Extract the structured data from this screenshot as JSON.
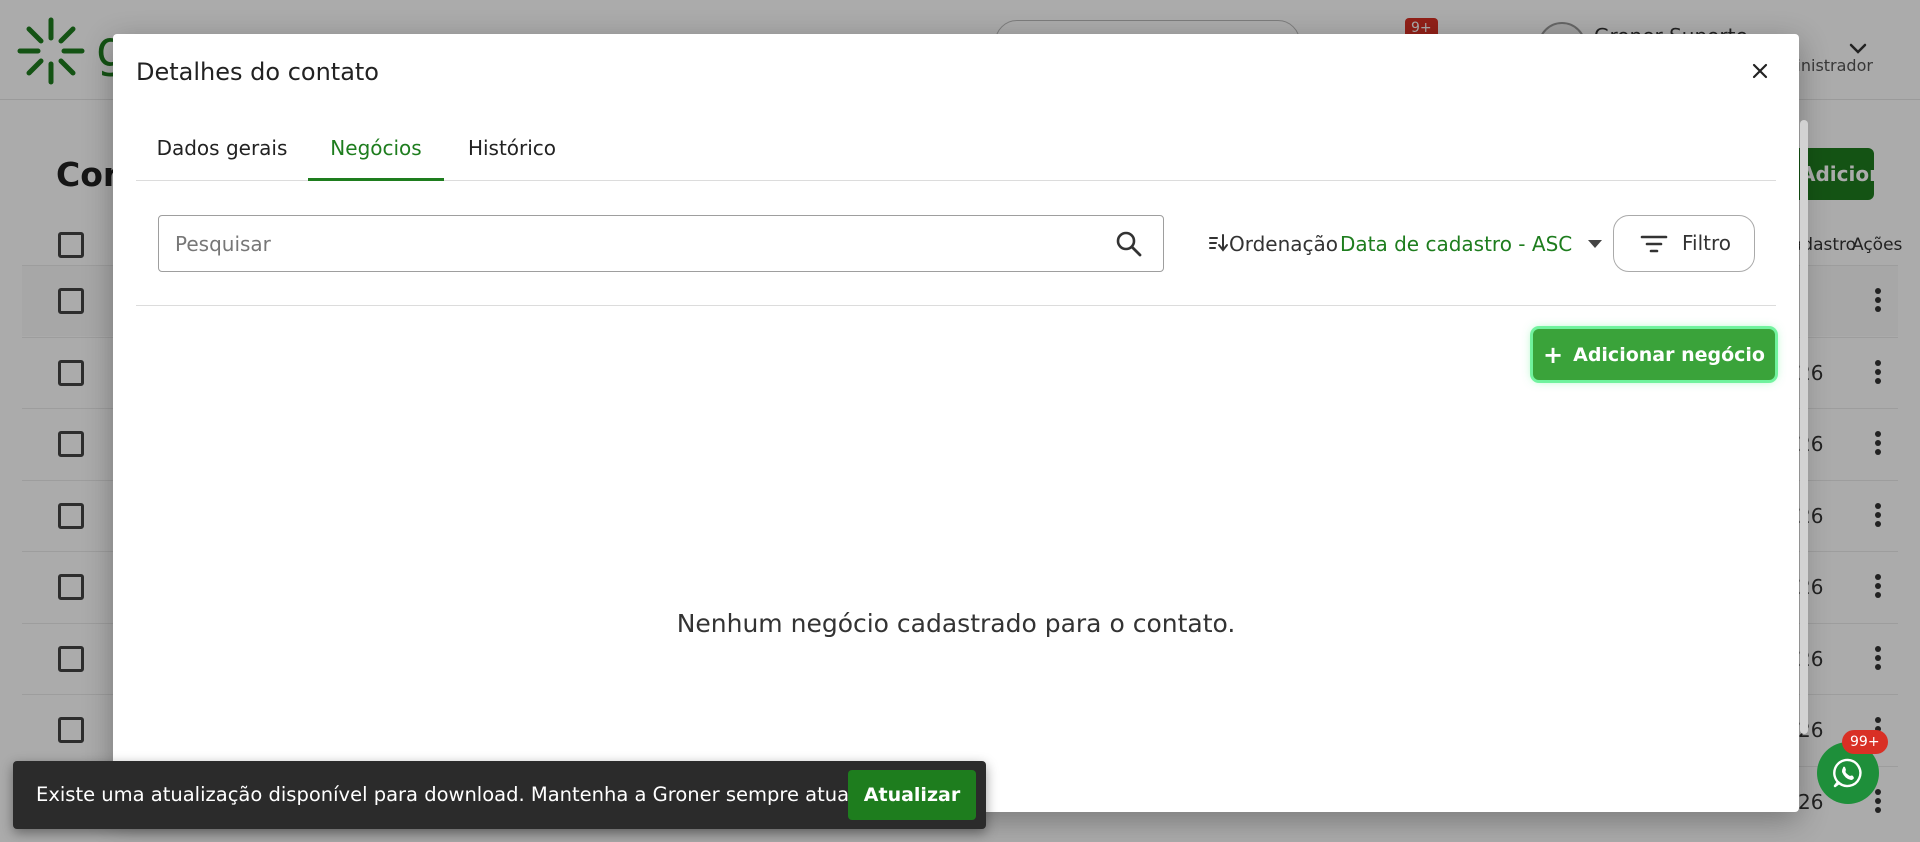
{
  "background": {
    "notification_badge": "9+",
    "user_name": "Groner Suporte",
    "user_role": "Administrador",
    "page_heading": "Contatos",
    "add_button": "Adicionar",
    "column_status": "Cadastro",
    "column_actions": "Ações",
    "row_date_suffix": "26",
    "rows": 8
  },
  "modal": {
    "title": "Detalhes do contato",
    "tabs": [
      {
        "label": "Dados gerais",
        "active": false
      },
      {
        "label": "Negócios",
        "active": true
      },
      {
        "label": "Histórico",
        "active": false
      }
    ],
    "search": {
      "placeholder": "Pesquisar",
      "value": ""
    },
    "sort": {
      "label": "Ordenação",
      "value": "Data de cadastro - ASC"
    },
    "filter_label": "Filtro",
    "add_deal_label": "Adicionar negócio",
    "empty_message": "Nenhum negócio cadastrado para o contato."
  },
  "snackbar": {
    "message": "Existe uma atualização disponível para download. Mantenha a Groner sempre atualizada!",
    "action": "Atualizar"
  },
  "whatsapp": {
    "badge": "99+"
  },
  "colors": {
    "primary_green": "#1e7d1e",
    "add_button_green": "#3aa33a",
    "badge_red": "#d93025"
  }
}
